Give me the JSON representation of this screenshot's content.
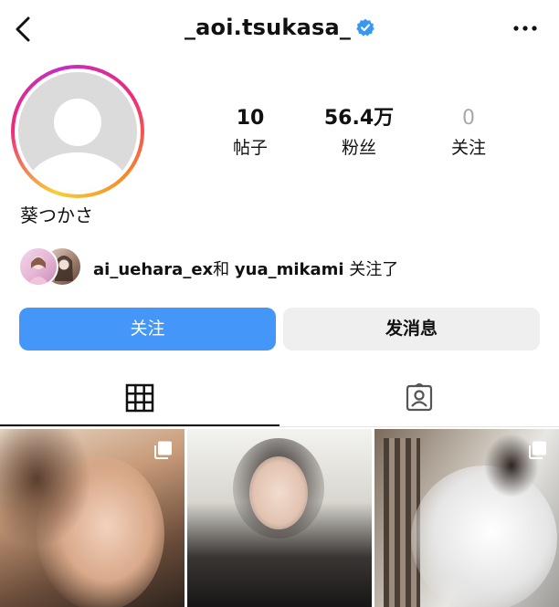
{
  "header": {
    "username": "_aoi.tsukasa_",
    "verified": true
  },
  "profile": {
    "display_name": "葵つかさ",
    "stats": {
      "posts_count": "10",
      "posts_label": "帖子",
      "followers_count": "56.4万",
      "followers_label": "粉丝",
      "following_count": "0",
      "following_label": "关注"
    }
  },
  "mutual": {
    "user1": "ai_uehara_ex",
    "conj": "和",
    "user2": "yua_mikami",
    "suffix": "关注了"
  },
  "actions": {
    "follow_label": "关注",
    "message_label": "发消息"
  },
  "tabs": [
    {
      "icon": "grid-icon",
      "active": true
    },
    {
      "icon": "tagged-icon",
      "active": false
    }
  ],
  "colors": {
    "primary": "#4497f8",
    "secondary_button": "#efefef",
    "verified": "#3897f0"
  },
  "posts": [
    {
      "type": "carousel"
    },
    {
      "type": "single"
    },
    {
      "type": "carousel"
    }
  ]
}
